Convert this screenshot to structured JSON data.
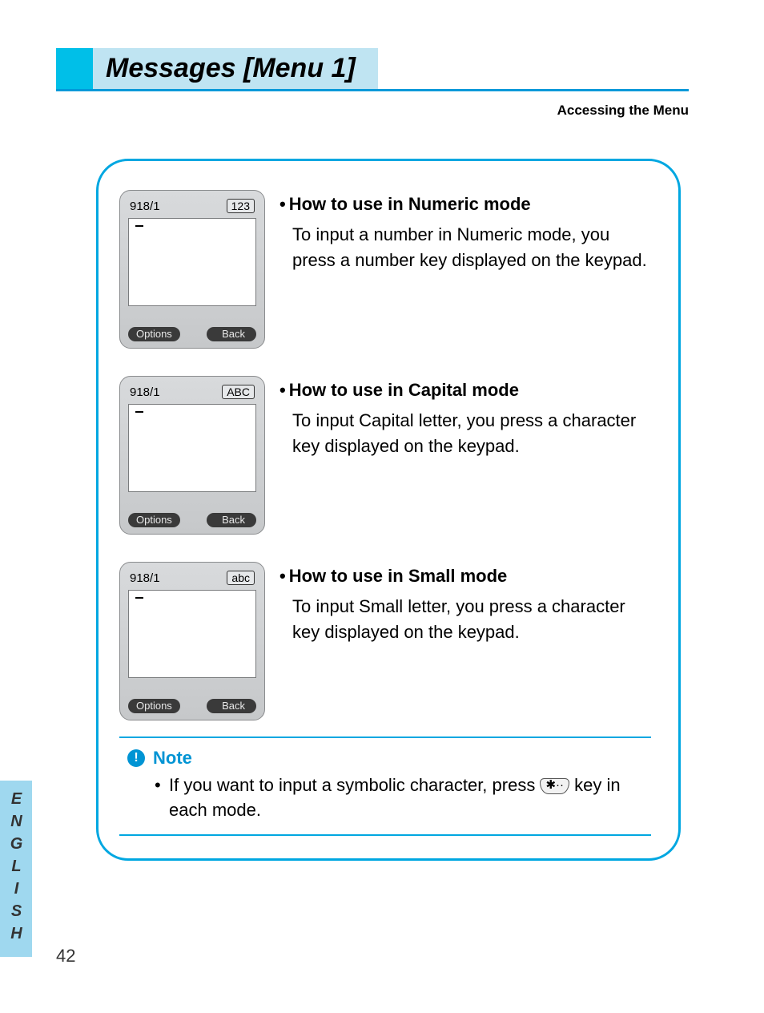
{
  "header": {
    "title": "Messages [Menu 1]",
    "subtitle": "Accessing the Menu"
  },
  "phone_common": {
    "counter": "918/1",
    "softkey_left": "Options",
    "softkey_right": "Back"
  },
  "modes": [
    {
      "badge": "123",
      "heading": "How to use in Numeric mode",
      "body": "To input a number in Numeric mode, you press a number key displayed on the keypad."
    },
    {
      "badge": "ABC",
      "heading": "How to use in Capital mode",
      "body": "To input Capital letter, you press a character key displayed on the keypad."
    },
    {
      "badge": "abc",
      "heading": "How to use in Small mode",
      "body": "To input Small letter, you press a character key displayed on the keypad."
    }
  ],
  "note": {
    "title": "Note",
    "line_a": "If you want to input a symbolic character, press ",
    "key_glyph": "✱··",
    "line_b": " key in each mode."
  },
  "side_tab": "ENGLISH",
  "page_number": "42"
}
